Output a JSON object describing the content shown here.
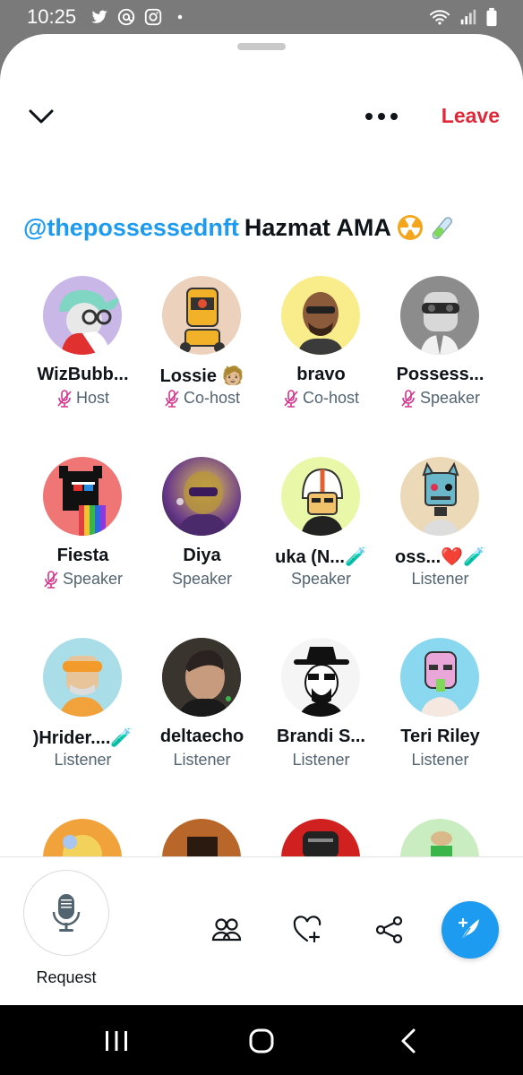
{
  "status_bar": {
    "time": "10:25",
    "left_icons": [
      "twitter-icon",
      "threads-icon",
      "instagram-icon",
      "dot-icon"
    ],
    "right_icons": [
      "wifi-icon",
      "signal-icon",
      "battery-icon"
    ]
  },
  "header": {
    "leave_label": "Leave",
    "title_handle": "@thepossessednft",
    "title_text": "Hazmat AMA",
    "title_emoji": "☢🧪"
  },
  "participants": [
    {
      "name": "WizBubb...",
      "role": "Host",
      "muted": true
    },
    {
      "name": "Lossie",
      "role": "Co-host",
      "muted": true,
      "suffix": "🧑🏼"
    },
    {
      "name": "bravo",
      "role": "Co-host",
      "muted": true
    },
    {
      "name": "Possess...",
      "role": "Speaker",
      "muted": true
    },
    {
      "name": "Fiesta",
      "role": "Speaker",
      "muted": true
    },
    {
      "name": "Diya",
      "role": "Speaker",
      "muted": false
    },
    {
      "name": "uka (N...",
      "role": "Speaker",
      "muted": false,
      "suffix": "🧪"
    },
    {
      "name": "oss...",
      "role": "Listener",
      "muted": false,
      "suffix": "❤️🧪"
    },
    {
      "name": ")Hrider....",
      "role": "Listener",
      "muted": false,
      "suffix": "🧪"
    },
    {
      "name": "deltaecho",
      "role": "Listener",
      "muted": false
    },
    {
      "name": "Brandi S...",
      "role": "Listener",
      "muted": false
    },
    {
      "name": "Teri Riley",
      "role": "Listener",
      "muted": false
    },
    {
      "name": "",
      "role": "",
      "muted": false
    },
    {
      "name": "",
      "role": "",
      "muted": false
    },
    {
      "name": "",
      "role": "",
      "muted": false
    },
    {
      "name": "",
      "role": "",
      "muted": false
    }
  ],
  "bottom_bar": {
    "request_label": "Request",
    "icons": [
      "people-icon",
      "heart-plus-icon",
      "share-icon",
      "compose-icon"
    ]
  },
  "colors": {
    "accent": "#1d9bf0",
    "leave": "#e02a3a",
    "muted_mic": "#d6338b",
    "role_text": "#536471"
  }
}
